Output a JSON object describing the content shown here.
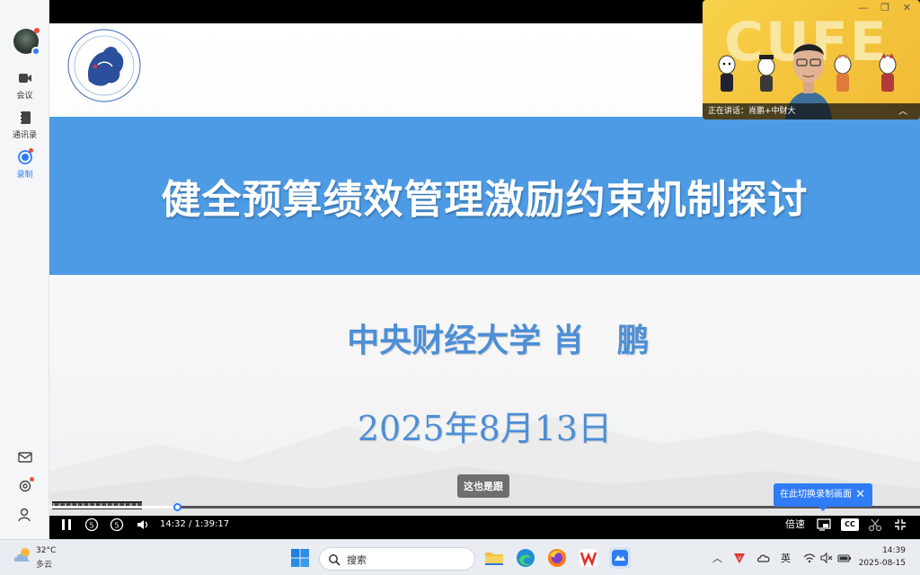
{
  "sidebar": {
    "items": [
      {
        "label": "会议",
        "icon": "video-camera-icon"
      },
      {
        "label": "通讯录",
        "icon": "address-book-icon"
      },
      {
        "label": "录制",
        "icon": "record-icon",
        "active": true
      }
    ],
    "bottom_icons": [
      "mail-icon",
      "settings-icon",
      "user-icon"
    ]
  },
  "slide": {
    "title": "健全预算绩效管理激励约束机制探讨",
    "speaker": "中央财经大学 肖　鹏",
    "date": "2025年8月13日"
  },
  "subtitle": "这也是跟",
  "camera": {
    "speaking_label": "正在讲话：肖鹏+中财大",
    "window_controls": [
      "—",
      "❐",
      "✕"
    ]
  },
  "player": {
    "time": "14:32 / 1:39:17",
    "progress_fraction": 0.1464,
    "speed_label": "倍速",
    "cc_label": "CC",
    "tip": "在此切换录制画面",
    "skip_back": "5",
    "skip_forward": "5"
  },
  "taskbar": {
    "weather_temp": "32°C",
    "weather_desc": "多云",
    "search_placeholder": "搜索",
    "ime_label": "英",
    "time": "14:39",
    "date": "2025-08-15"
  },
  "colors": {
    "banner": "#4d9be5",
    "slide_text": "#4d8fd6",
    "accent": "#2f7cf6"
  }
}
